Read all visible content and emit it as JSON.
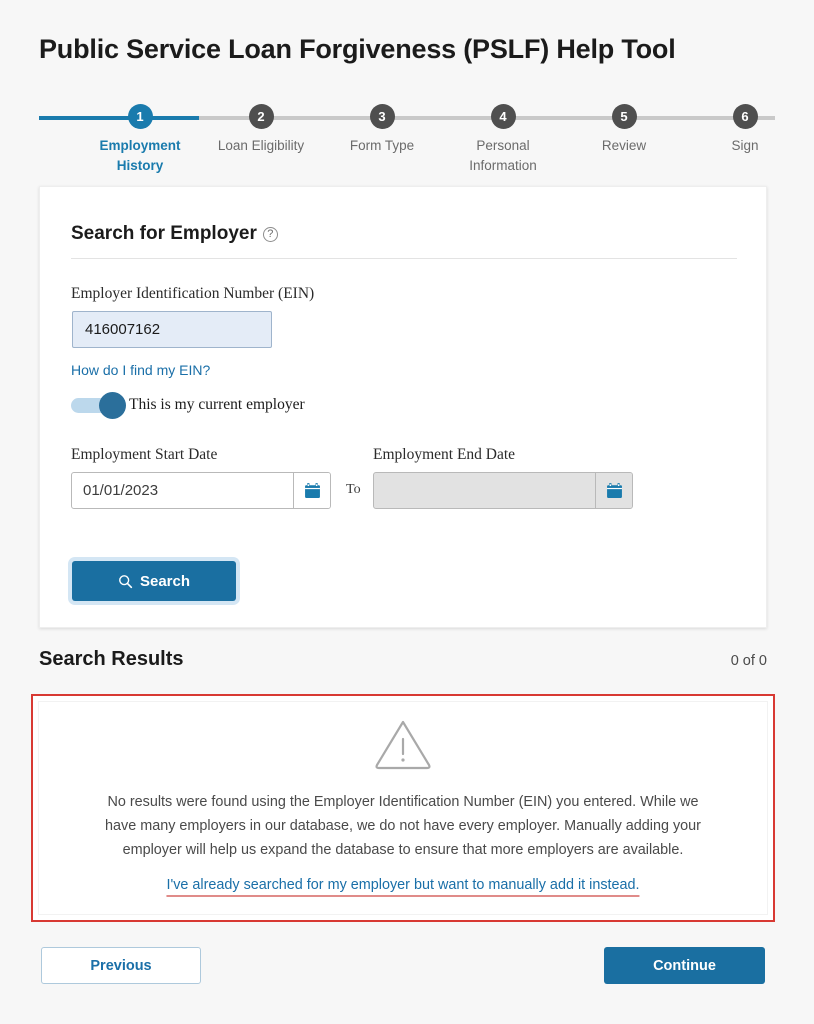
{
  "header": {
    "title": "Public Service Loan Forgiveness (PSLF) Help Tool"
  },
  "stepper": {
    "current_step": 1,
    "steps": [
      {
        "number": "1",
        "label": "Employment History",
        "state": "active"
      },
      {
        "number": "2",
        "label": "Loan Eligibility",
        "state": "inactive"
      },
      {
        "number": "3",
        "label": "Form Type",
        "state": "inactive"
      },
      {
        "number": "4",
        "label": "Personal Information",
        "state": "inactive"
      },
      {
        "number": "5",
        "label": "Review",
        "state": "inactive"
      },
      {
        "number": "6",
        "label": "Sign",
        "state": "inactive"
      }
    ]
  },
  "search_card": {
    "title": "Search for Employer",
    "help_icon": "question-circle-icon",
    "ein": {
      "label": "Employer Identification Number (EIN)",
      "value": "416007162",
      "placeholder": "",
      "help_link": "How do I find my EIN?"
    },
    "current_employer_toggle": {
      "label": "This is my current employer",
      "state": "on"
    },
    "start_date": {
      "label": "Employment Start Date",
      "value": "01/01/2023",
      "placeholder": "",
      "calendar_icon": "calendar-icon"
    },
    "separator": "To",
    "end_date": {
      "label": "Employment End Date",
      "value": "",
      "placeholder": "",
      "disabled": true,
      "calendar_icon": "calendar-icon"
    },
    "search_button": {
      "label": "Search",
      "icon": "search-icon"
    }
  },
  "results": {
    "title": "Search Results",
    "count": "0 of 0",
    "error": {
      "icon": "warning-triangle-icon",
      "message": "No results were found using the Employer Identification Number (EIN) you entered. While we have many employers in our database, we do not have every employer. Manually adding your employer will help us expand the database to ensure that more employers are available.",
      "link": "I've already searched for my employer but want to manually add it instead."
    }
  },
  "footer": {
    "previous_label": "Previous",
    "continue_label": "Continue"
  },
  "colors": {
    "accent_blue": "#1a6fa1",
    "step_active": "#1a7bad",
    "step_inactive": "#4f4f4f",
    "link_blue": "#1a6fa8",
    "error_red": "#d83933",
    "page_bg": "#f7f7f7"
  }
}
